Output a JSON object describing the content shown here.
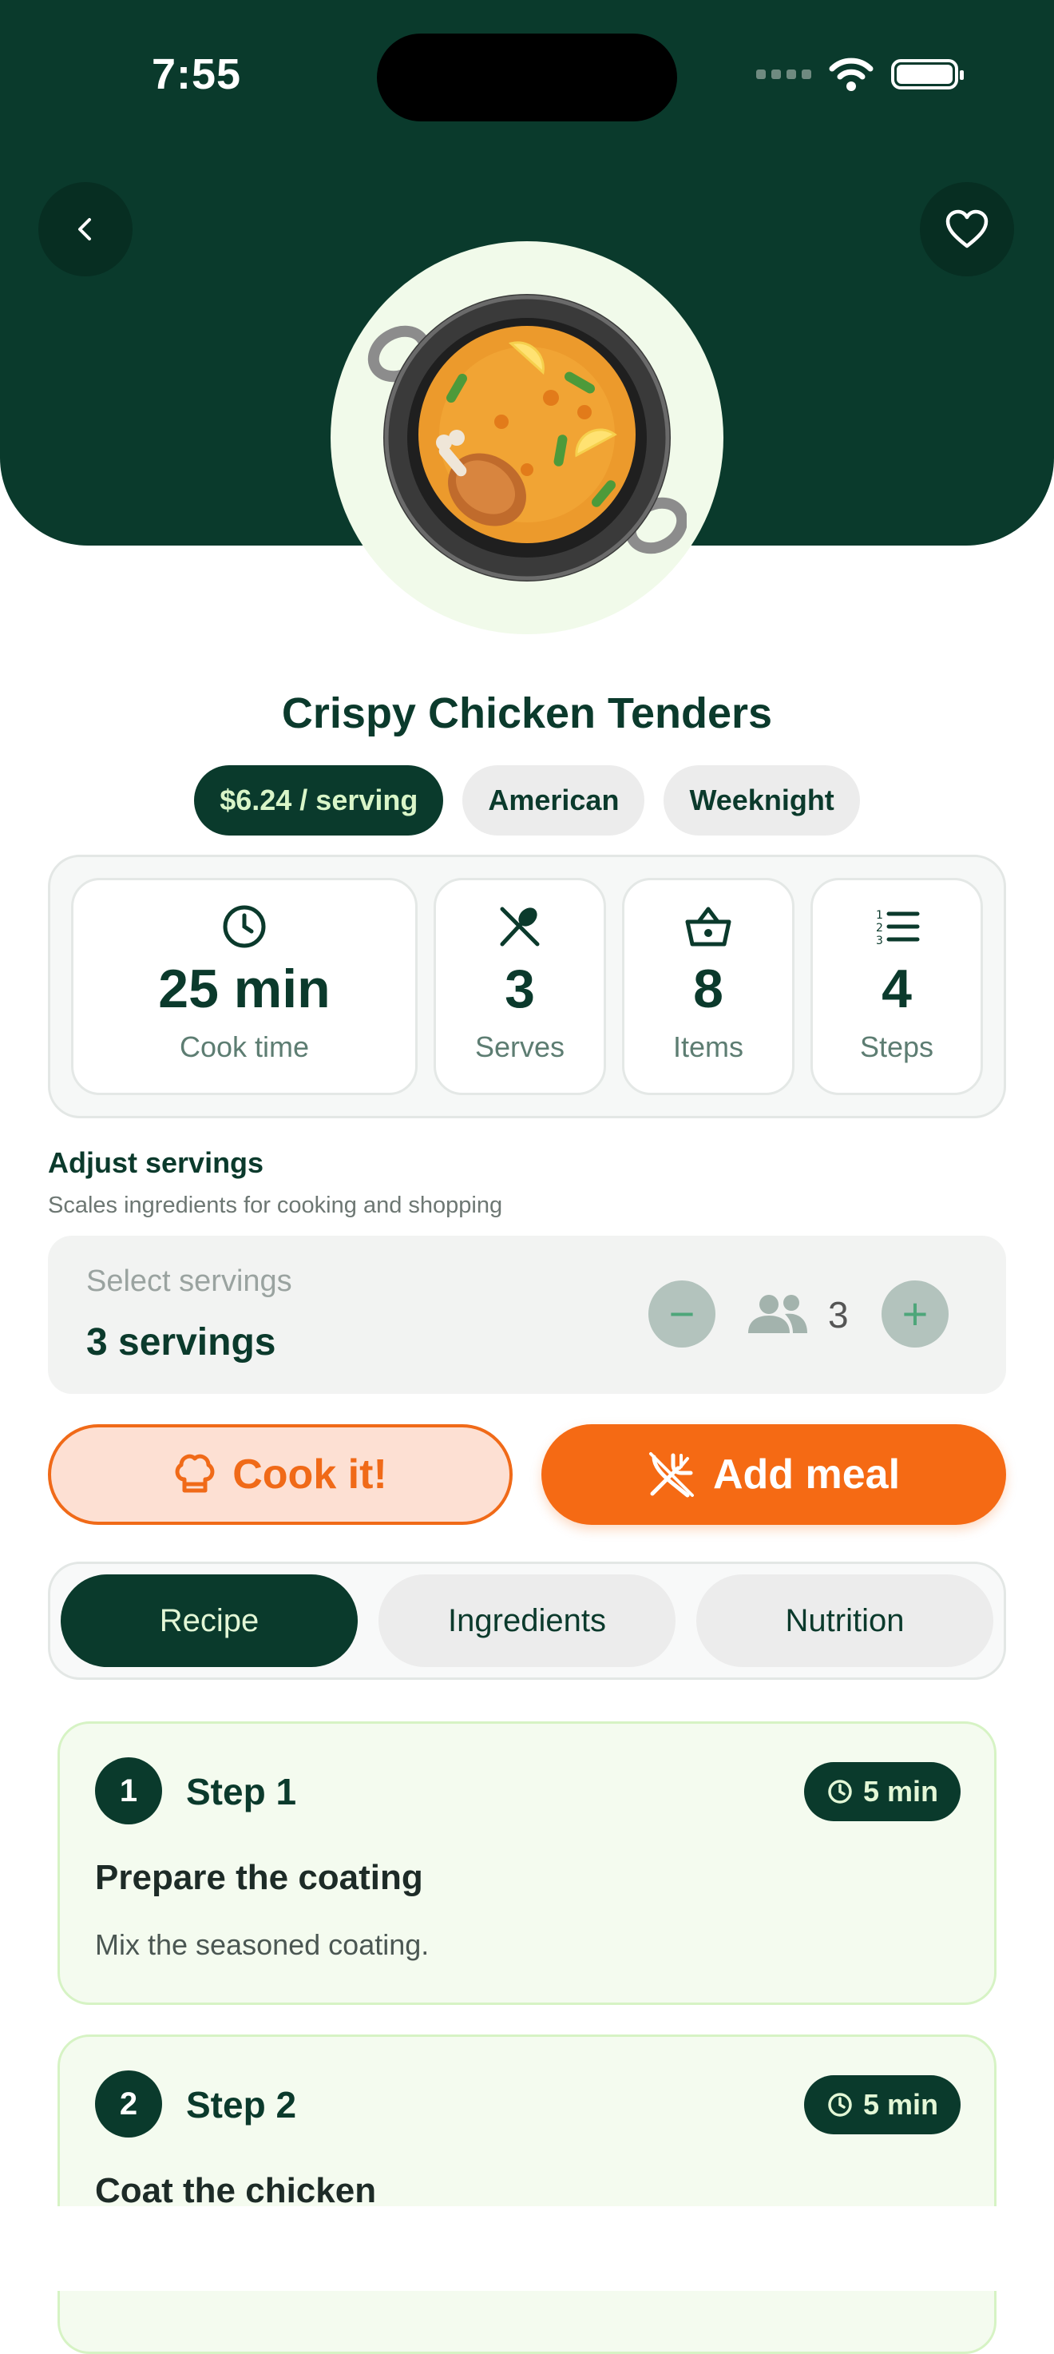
{
  "status_bar": {
    "time": "7:55"
  },
  "recipe": {
    "title": "Crispy Chicken Tenders",
    "chips": [
      "$6.24 / serving",
      "American",
      "Weeknight"
    ]
  },
  "stats": [
    {
      "icon": "clock-icon",
      "value": "25 min",
      "label": "Cook time"
    },
    {
      "icon": "utensils-icon",
      "value": "3",
      "label": "Serves"
    },
    {
      "icon": "basket-icon",
      "value": "8",
      "label": "Items"
    },
    {
      "icon": "list-icon",
      "value": "4",
      "label": "Steps"
    }
  ],
  "servings": {
    "title": "Adjust servings",
    "subtitle": "Scales ingredients for cooking and shopping",
    "placeholder": "Select servings",
    "value": "3 servings",
    "count": "3",
    "minus": "−",
    "plus": "+"
  },
  "actions": {
    "cook": "Cook it!",
    "add": "Add meal"
  },
  "tabs": [
    "Recipe",
    "Ingredients",
    "Nutrition"
  ],
  "steps": [
    {
      "number": "1",
      "label": "Step 1",
      "time": "5 min",
      "title": "Prepare the coating",
      "description": "Mix the seasoned coating."
    },
    {
      "number": "2",
      "label": "Step 2",
      "time": "5 min",
      "title": "Coat the chicken",
      "description": ""
    }
  ],
  "colors": {
    "primary": "#0a3a2c",
    "accent": "#f56a14",
    "card_bg": "#f4fbef"
  }
}
